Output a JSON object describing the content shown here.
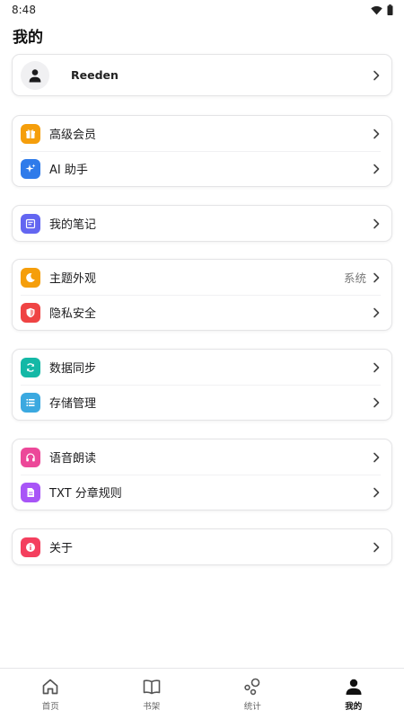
{
  "status": {
    "time": "8:48",
    "wifi_icon": "wifi-icon",
    "battery_icon": "battery-icon"
  },
  "page": {
    "title": "我的"
  },
  "profile": {
    "name": "Reeden",
    "avatar_icon": "person-icon"
  },
  "groups": [
    {
      "items": [
        {
          "label": "高级会员",
          "icon": "gift-icon",
          "color": "#F59E0B"
        },
        {
          "label": "AI 助手",
          "icon": "sparkle-icon",
          "color": "#2F7BEA"
        }
      ]
    },
    {
      "items": [
        {
          "label": "我的笔记",
          "icon": "note-icon",
          "color": "#6366F1"
        }
      ]
    },
    {
      "items": [
        {
          "label": "主题外观",
          "icon": "moon-icon",
          "color": "#F59E0B",
          "value": "系统"
        },
        {
          "label": "隐私安全",
          "icon": "shield-icon",
          "color": "#EF4444"
        }
      ]
    },
    {
      "items": [
        {
          "label": "数据同步",
          "icon": "sync-icon",
          "color": "#14B8A6"
        },
        {
          "label": "存储管理",
          "icon": "list-icon",
          "color": "#3BA9E0"
        }
      ]
    },
    {
      "items": [
        {
          "label": "语音朗读",
          "icon": "headphones-icon",
          "color": "#EC4899"
        },
        {
          "label": "TXT 分章规则",
          "icon": "file-icon",
          "color": "#A855F7"
        }
      ]
    },
    {
      "items": [
        {
          "label": "关于",
          "icon": "info-icon",
          "color": "#F43F5E"
        }
      ]
    }
  ],
  "nav": {
    "active_color": "#111111",
    "items": [
      {
        "label": "首页",
        "icon": "home-icon"
      },
      {
        "label": "书架",
        "icon": "book-icon"
      },
      {
        "label": "统计",
        "icon": "stats-icon"
      },
      {
        "label": "我的",
        "icon": "profile-icon",
        "active": true
      }
    ]
  }
}
